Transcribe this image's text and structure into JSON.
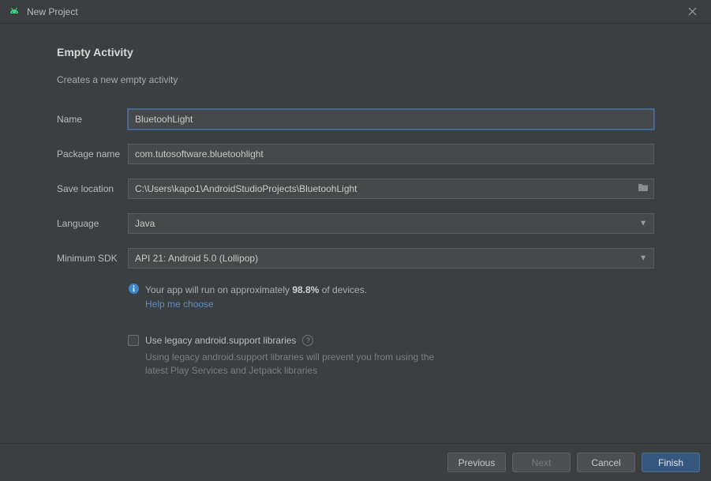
{
  "window": {
    "title": "New Project"
  },
  "page": {
    "heading": "Empty Activity",
    "subheading": "Creates a new empty activity"
  },
  "fields": {
    "name_label": "Name",
    "name_value": "BluetoohLight",
    "package_label": "Package name",
    "package_value": "com.tutosoftware.bluetoohlight",
    "save_label": "Save location",
    "save_value": "C:\\Users\\kapo1\\AndroidStudioProjects\\BluetoohLight",
    "language_label": "Language",
    "language_value": "Java",
    "minsdk_label": "Minimum SDK",
    "minsdk_value": "API 21: Android 5.0 (Lollipop)"
  },
  "info": {
    "prefix": "Your app will run on approximately ",
    "percent": "98.8%",
    "suffix": " of devices.",
    "help_link": "Help me choose"
  },
  "legacy": {
    "label": "Use legacy android.support libraries",
    "hint": "Using legacy android.support libraries will prevent you from using the latest Play Services and Jetpack libraries"
  },
  "buttons": {
    "previous": "Previous",
    "next": "Next",
    "cancel": "Cancel",
    "finish": "Finish"
  }
}
